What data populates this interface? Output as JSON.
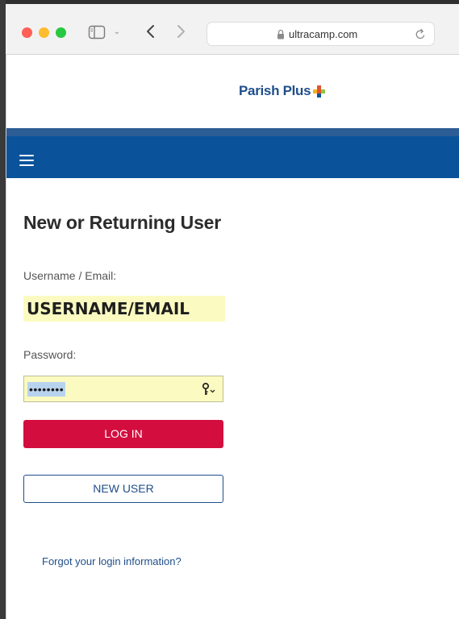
{
  "browser": {
    "url": "ultracamp.com",
    "icons": [
      "sidebar-icon",
      "chevron-down-icon",
      "back-arrow-icon",
      "forward-arrow-icon",
      "lock-icon",
      "reload-icon"
    ]
  },
  "header": {
    "logo_text": "Parish Plus",
    "logo_plus_colors": [
      "#e0542e",
      "#8cc63f",
      "#0a539b",
      "#f6b21a"
    ]
  },
  "nav": {
    "menu_icon": "hamburger-icon",
    "bar_color": "#0a539b"
  },
  "login": {
    "title": "New or Returning User",
    "username_label": "Username / Email:",
    "username_value": "USERNAME/EMAIL",
    "password_label": "Password:",
    "password_value": "••••••••",
    "password_key_icon": "key-icon",
    "login_button": "LOG IN",
    "login_button_color": "#d40d3f",
    "new_user_button": "NEW USER",
    "forgot_link": "Forgot your login information?"
  }
}
